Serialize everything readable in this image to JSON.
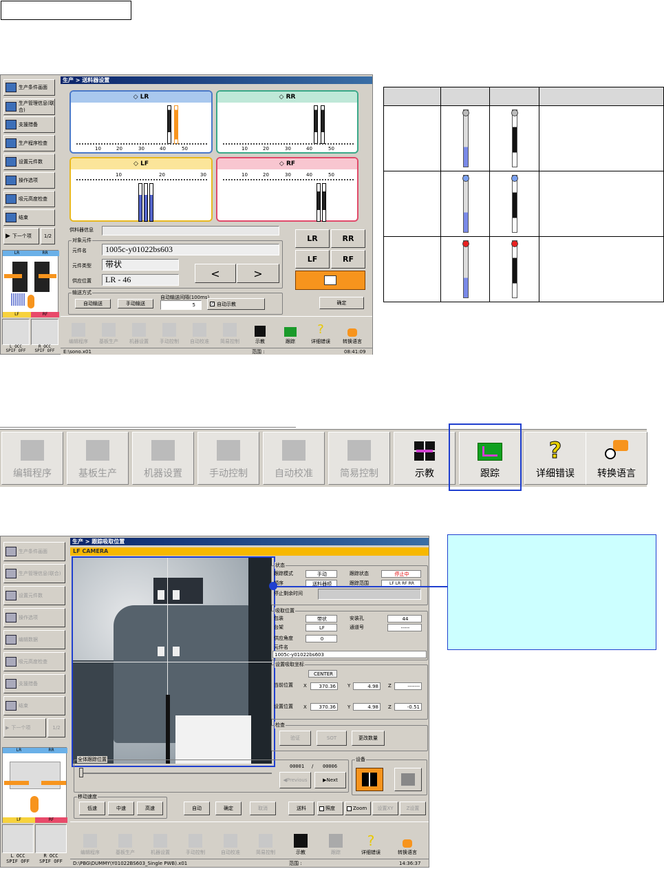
{
  "top_label": "",
  "screen1": {
    "title": "生产 > 送料器设置",
    "sidebar": [
      {
        "label": "生产条件画面",
        "icon": "production-condition-icon"
      },
      {
        "label": "生产管理信息(联合)",
        "icon": "production-info-icon"
      },
      {
        "label": "支援措备",
        "icon": "support-icon"
      },
      {
        "label": "生产程序检查",
        "icon": "program-check-icon"
      },
      {
        "label": "设置元件数",
        "icon": "parts-count-icon"
      },
      {
        "label": "操作选项",
        "icon": "operation-option-icon"
      },
      {
        "label": "吸元高度检查",
        "icon": "height-check-icon"
      },
      {
        "label": "结束",
        "icon": "exit-icon"
      }
    ],
    "next_label": "下一个项",
    "page_label": "1/2",
    "quadrants": {
      "lr": "LR",
      "rr": "RR",
      "lf": "LF",
      "rf": "RF"
    },
    "ruler_ticks": [
      "10",
      "20",
      "30",
      "40",
      "50"
    ],
    "lf_ticks": [
      "10",
      "20",
      "30"
    ],
    "feeder_info_label": "供料器信息",
    "target_parts_label": "对象元件",
    "part_name_label": "元件名",
    "part_name": "1005c-y01022bs603",
    "part_type_label": "元件类型",
    "part_type": "带状",
    "supply_pos_label": "供应位置",
    "supply_pos": "LR - 46",
    "btn_prev": "<",
    "btn_next": ">",
    "btn_lr": "LR",
    "btn_rr": "RR",
    "btn_lf": "LF",
    "btn_rf": "RF",
    "transport_label": "输送方式",
    "auto_send": "自动输送",
    "manual_send": "手动输送",
    "interval_label": "自动输送间隔(100ms)",
    "interval_value": "5",
    "auto_display": "自动示教",
    "confirm": "确定",
    "toolbar": [
      "编辑程序",
      "基板生产",
      "机器设置",
      "手动控制",
      "自动校准",
      "简易控制",
      "示教",
      "跟踪",
      "详细错误",
      "转换语言"
    ],
    "status_path": "E:\\sono.x01",
    "status_range": "范围 :",
    "status_time": "08:41:09",
    "occ_left": "L OCC\nSPIF OFF",
    "occ_right": "R OCC\nSPIF OFF",
    "minimap_lr": "LR",
    "minimap_rr": "RR",
    "minimap_lf": "LF",
    "minimap_rf": "RF"
  },
  "legend_table": {
    "headers": [
      "",
      "",
      "",
      ""
    ],
    "rows": [
      {
        "indicator": "gray"
      },
      {
        "indicator": "blue"
      },
      {
        "indicator": "red"
      }
    ]
  },
  "big_toolbar": [
    {
      "label": "编辑程序",
      "icon": "edit-program-icon",
      "active": false
    },
    {
      "label": "基板生产",
      "icon": "board-production-icon",
      "active": false
    },
    {
      "label": "机器设置",
      "icon": "machine-setup-icon",
      "active": false
    },
    {
      "label": "手动控制",
      "icon": "manual-control-icon",
      "active": false
    },
    {
      "label": "自动校准",
      "icon": "auto-calibrate-icon",
      "active": false
    },
    {
      "label": "简易控制",
      "icon": "simple-control-icon",
      "active": false
    },
    {
      "label": "示教",
      "icon": "teach-icon",
      "active": true
    },
    {
      "label": "跟踪",
      "icon": "track-icon",
      "active": true
    },
    {
      "label": "详细错误",
      "icon": "error-detail-icon",
      "active": true
    },
    {
      "label": "转换语言",
      "icon": "language-icon",
      "active": true
    }
  ],
  "screen2": {
    "title": "生产 > 跟踪吸取位置",
    "camera_label": "LF CAMERA",
    "sidebar": [
      {
        "label": "生产条件画面"
      },
      {
        "label": "生产管理信息(联合)"
      },
      {
        "label": "设置元件数"
      },
      {
        "label": "操作选项"
      },
      {
        "label": "编辑数据"
      },
      {
        "label": "吸元高度检查"
      },
      {
        "label": "支援措备"
      },
      {
        "label": "结束"
      }
    ],
    "next_label": "下一个项",
    "page_label": "1/2",
    "status_group": "状态",
    "track_mode_label": "跟踪模式",
    "track_mode": "手动",
    "track_state_label": "跟踪状态",
    "track_state": "停止中",
    "order_label": "顺序",
    "order": "送料器顺",
    "range_label": "跟踪范围",
    "range": "LF LR RF RR",
    "remain_label": "停止剩余时间",
    "pickup_group": "吸取位置",
    "pack_label": "包装",
    "pack": "带状",
    "hole_label": "安装孔",
    "hole": "44",
    "table_label": "台架",
    "table": "LF",
    "lane_label": "通道号",
    "lane": "-----",
    "angle_label": "供应角度",
    "angle": "0",
    "part_label": "元件名",
    "part": "1005c-y01022bs603",
    "coord_group": "设置吸取坐标",
    "center": "CENTER",
    "current_label": "当前位置",
    "cur_x_label": "X",
    "cur_x": "370.36",
    "cur_y_label": "Y",
    "cur_y": "4.98",
    "cur_z_label": "Z",
    "cur_z": "-------",
    "set_label": "设置位置",
    "set_x_label": "X",
    "set_x": "370.36",
    "set_y_label": "Y",
    "set_y": "4.98",
    "set_z_label": "Z",
    "set_z": "-0.51",
    "check_group": "检查",
    "verify": "验证",
    "sot": "SOT",
    "change_qty": "更改数量",
    "overall_group": "全体跟踪位置",
    "counter_cur": "00001",
    "counter_sep": "/",
    "counter_total": "00006",
    "previous": "Previous",
    "next": "Next",
    "settings_group": "设备",
    "speed_group": "移动速度",
    "low": "低速",
    "mid": "中速",
    "high": "高速",
    "auto": "自动",
    "confirm": "确定",
    "cancel": "取消",
    "send": "送料",
    "light_chk": "照度",
    "zoom_chk": "Zoom",
    "set_xy": "设置XY",
    "z_set": "Z设置",
    "toolbar": [
      "编辑程序",
      "基板生产",
      "机器设置",
      "手动控制",
      "自动校准",
      "简易控制",
      "示教",
      "跟踪",
      "详细错误",
      "转换语言"
    ],
    "status_path": "D:\\PBG\\DUMMY\\Y01022BS603_Single PWB).x01",
    "status_range": "范围 :",
    "status_time": "14:36:37",
    "occ_left": "L OCC\nSPIF OFF",
    "occ_right": "R OCC\nSPIF OFF",
    "minimap_lr": "LR",
    "minimap_rr": "RR",
    "minimap_lf": "LF",
    "minimap_rf": "RF"
  },
  "callout": {
    "text": ""
  },
  "colors": {
    "highlight": "#1f3fcf",
    "callout_bg": "#ccffff",
    "accent_orange": "#f7941d"
  }
}
